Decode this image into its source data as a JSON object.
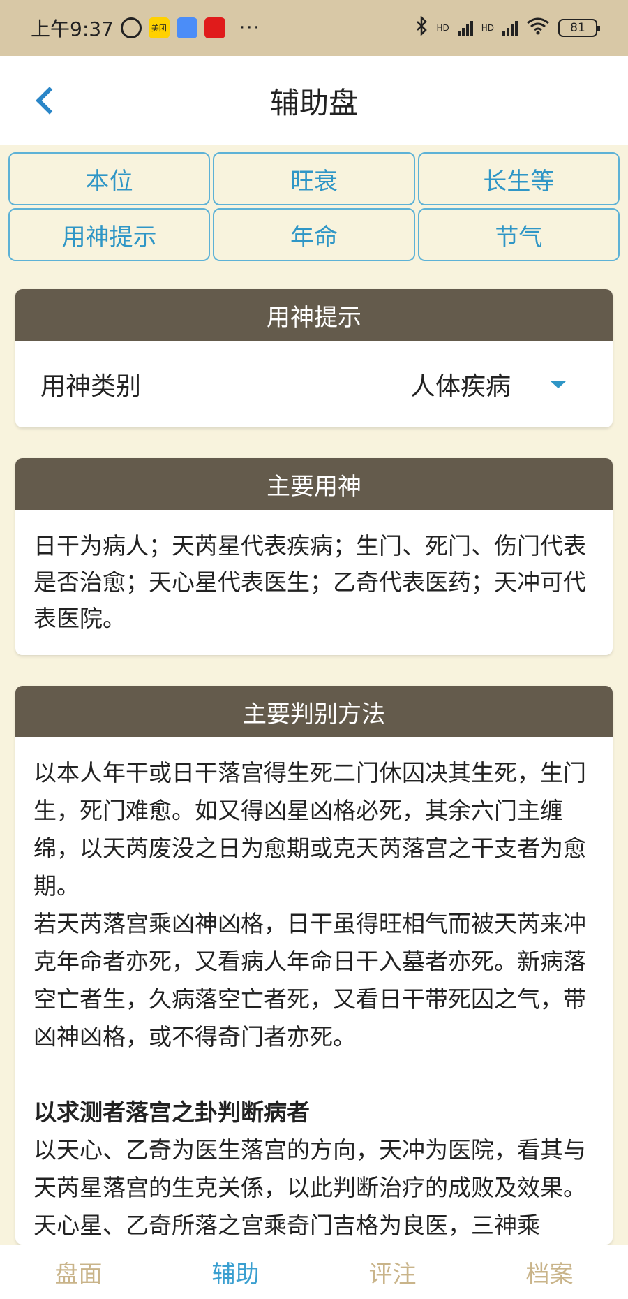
{
  "status_bar": {
    "time": "上午9:37",
    "app_icons": [
      {
        "name": "alarm-icon",
        "label": ""
      },
      {
        "name": "meituan-app-icon",
        "label": "美团"
      },
      {
        "name": "blue-app-icon",
        "label": ""
      },
      {
        "name": "red-app-icon",
        "label": ""
      }
    ],
    "more": "···",
    "hd1": "HD",
    "hd2": "HD",
    "battery": "81"
  },
  "header": {
    "title": "辅助盘"
  },
  "tabs": [
    {
      "label": "本位"
    },
    {
      "label": "旺衰"
    },
    {
      "label": "长生等"
    },
    {
      "label": "用神提示"
    },
    {
      "label": "年命"
    },
    {
      "label": "节气"
    }
  ],
  "yongshen_card": {
    "title": "用神提示",
    "category_label": "用神类别",
    "category_value": "人体疾病"
  },
  "main_yongshen_card": {
    "title": "主要用神",
    "body": "日干为病人；天芮星代表疾病；生门、死门、伤门代表是否治愈；天心星代表医生；乙奇代表医药；天冲可代表医院。"
  },
  "method_card": {
    "title": "主要判别方法",
    "para1": "以本人年干或日干落宫得生死二门休囚决其生死，生门生，死门难愈。如又得凶星凶格必死，其余六门主缠绵，以天芮废没之日为愈期或克天芮落宫之干支者为愈期。",
    "para2": "若天芮落宫乘凶神凶格，日干虽得旺相气而被天芮来冲克年命者亦死，又看病人年命日干入墓者亦死。新病落空亡者生，久病落空亡者死，又看日干带死囚之气，带凶神凶格，或不得奇门者亦死。",
    "subtitle": "以求测者落宫之卦判断病者",
    "para3": "以天心、乙奇为医生落宫的方向，天冲为医院，看其与天芮星落宫的生克关係，以此判断治疗的成败及效果。",
    "para4": "天心星、乙奇所落之宫乘奇门吉格为良医，三神乘"
  },
  "bottom_nav": [
    {
      "label": "盘面",
      "active": false
    },
    {
      "label": "辅助",
      "active": true
    },
    {
      "label": "评注",
      "active": false
    },
    {
      "label": "档案",
      "active": false
    }
  ],
  "colors": {
    "accent_blue": "#2f96c6",
    "card_header": "#645b4c",
    "background": "#f8f3dd",
    "status_bar": "#d8c8a6",
    "nav_inactive": "#c9b48a"
  }
}
